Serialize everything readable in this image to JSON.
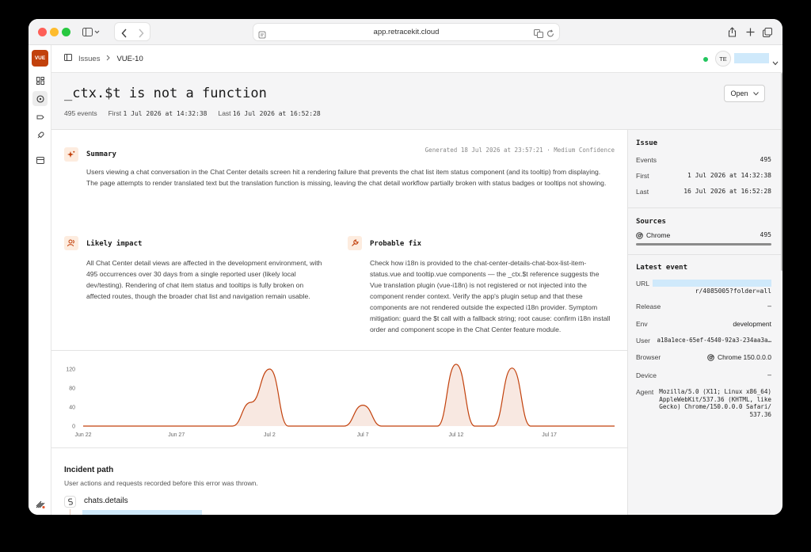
{
  "browser": {
    "url": "app.retracekit.cloud",
    "traffic_lights": [
      "#fe5f57",
      "#febc2e",
      "#28c840"
    ]
  },
  "rail": {
    "logo_text": "VUE",
    "brand_color": "#c2410c",
    "items": [
      "dashboard-icon",
      "issues-icon",
      "releases-icon",
      "deploy-icon",
      "billing-icon"
    ],
    "bottom_icon": "settings-icon"
  },
  "header": {
    "breadcrumb": [
      "Issues",
      "VUE-10"
    ],
    "user_initials": "TE",
    "status_dot_color": "#22c55e"
  },
  "issue": {
    "title": "_ctx.$t is not a function",
    "events_count": "495 events",
    "first_label": "First",
    "first_value": "1 Jul 2026 at 14:32:38",
    "last_label": "Last",
    "last_value": "16 Jul 2026 at 16:52:28",
    "status_button": "Open"
  },
  "summary": {
    "heading": "Summary",
    "generated": "Generated 18 Jul 2026 at 23:57:21 · Medium Confidence",
    "text": "Users viewing a chat conversation in the Chat Center details screen hit a rendering failure that prevents the chat list item status component (and its tooltip) from displaying. The page attempts to render translated text but the translation function is missing, leaving the chat detail workflow partially broken with status badges or tooltips not showing."
  },
  "impact": {
    "heading": "Likely impact",
    "text": "All Chat Center detail views are affected in the development environment, with 495 occurrences over 30 days from a single reported user (likely local dev/testing). Rendering of chat item status and tooltips is fully broken on affected routes, though the broader chat list and navigation remain usable."
  },
  "fix": {
    "heading": "Probable fix",
    "text": "Check how i18n is provided to the chat-center-details-chat-box-list-item-status.vue and tooltip.vue components — the _ctx.$t reference suggests the Vue translation plugin (vue-i18n) is not registered or not injected into the component render context. Verify the app's plugin setup and that these components are not rendered outside the expected i18n provider. Symptom mitigation: guard the $t call with a fallback string; root cause: confirm i18n install order and component scope in the Chat Center feature module."
  },
  "chart_data": {
    "type": "area",
    "ylim": [
      0,
      130
    ],
    "y_ticks": [
      0,
      40,
      80,
      120
    ],
    "x_ticks": [
      "Jun 22",
      "Jun 27",
      "Jul 2",
      "Jul 7",
      "Jul 12",
      "Jul 17"
    ],
    "x_tick_pos": [
      0,
      5,
      10,
      15,
      20,
      25
    ],
    "x_max": 28.5,
    "color": "#c2410c",
    "points": [
      {
        "x": 0,
        "y": 0
      },
      {
        "x": 8,
        "y": 0
      },
      {
        "x": 9,
        "y": 50
      },
      {
        "x": 10,
        "y": 120
      },
      {
        "x": 11,
        "y": 0
      },
      {
        "x": 14,
        "y": 0
      },
      {
        "x": 15,
        "y": 44
      },
      {
        "x": 16,
        "y": 0
      },
      {
        "x": 19,
        "y": 0
      },
      {
        "x": 20,
        "y": 130
      },
      {
        "x": 21,
        "y": 0
      },
      {
        "x": 22,
        "y": 0
      },
      {
        "x": 23,
        "y": 122
      },
      {
        "x": 24,
        "y": 0
      },
      {
        "x": 28.5,
        "y": 0
      }
    ]
  },
  "incident": {
    "heading": "Incident path",
    "subtitle": "User actions and requests recorded before this error was thrown.",
    "first_step": "chats.details"
  },
  "side": {
    "issue_heading": "Issue",
    "events_label": "Events",
    "events_value": "495",
    "first_label": "First",
    "first_value": "1 Jul 2026 at 14:32:38",
    "last_label": "Last",
    "last_value": "16 Jul 2026 at 16:52:28",
    "sources_heading": "Sources",
    "source_name": "Chrome",
    "source_count": "495",
    "latest_heading": "Latest event",
    "url_label": "URL",
    "url_value": "r/4085005?folder=all",
    "release_label": "Release",
    "release_value": "—",
    "env_label": "Env",
    "env_value": "development",
    "user_label": "User",
    "user_value": "a18a1ece-65ef-4540-92a3-234aa3a…",
    "browser_label": "Browser",
    "browser_value": "Chrome 150.0.0.0",
    "device_label": "Device",
    "device_value": "—",
    "agent_label": "Agent",
    "agent_value": [
      "Mozilla/5.0 (X11; Linux x86_64)",
      "AppleWebKit/537.36 (KHTML, like",
      "Gecko) Chrome/150.0.0.0 Safari/",
      "537.36"
    ]
  }
}
